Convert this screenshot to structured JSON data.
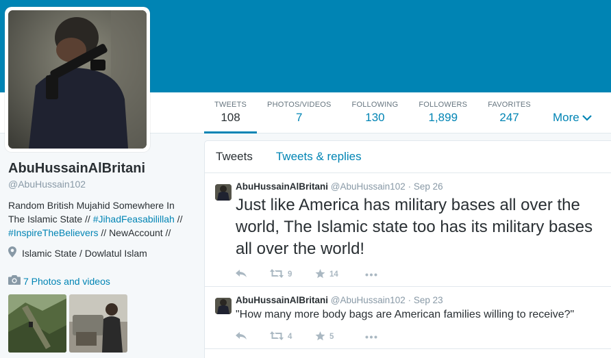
{
  "colors": {
    "brand": "#0084b4",
    "text": "#292f33",
    "muted": "#8899a6"
  },
  "profile": {
    "fullname": "AbuHussainAlBritani",
    "screenname": "@AbuHussain102",
    "bio_line1": "Random British Mujahid Somewhere In The Islamic State // ",
    "bio_tag1": "#JihadFeasabilillah",
    "bio_sep": " // ",
    "bio_tag2": "#InspireTheBelievers",
    "bio_tail": " // NewAccount //",
    "location": "Islamic State / Dowlatul Islam",
    "photos_link": "7 Photos and videos"
  },
  "stats": [
    {
      "label": "TWEETS",
      "value": "108"
    },
    {
      "label": "PHOTOS/VIDEOS",
      "value": "7"
    },
    {
      "label": "FOLLOWING",
      "value": "130"
    },
    {
      "label": "FOLLOWERS",
      "value": "1,899"
    },
    {
      "label": "FAVORITES",
      "value": "247"
    }
  ],
  "more_label": "More",
  "tabs": {
    "tweets": "Tweets",
    "replies": "Tweets & replies"
  },
  "tweets": [
    {
      "name": "AbuHussainAlBritani",
      "handle": "@AbuHussain102",
      "sep": "·",
      "date": "Sep 26",
      "text": "Just like America has military bases all over the world, The Islamic state too has its military bases all over the world!",
      "retweets": "9",
      "favorites": "14"
    },
    {
      "name": "AbuHussainAlBritani",
      "handle": "@AbuHussain102",
      "sep": "·",
      "date": "Sep 23",
      "text": "\"How many more body bags are American families willing to receive?\"",
      "retweets": "4",
      "favorites": "5"
    }
  ],
  "icons": {
    "location": "map-pin-icon",
    "camera": "camera-icon",
    "reply": "reply-icon",
    "retweet": "retweet-icon",
    "favorite": "star-icon",
    "more": "ellipsis-icon",
    "caret": "chevron-down-icon"
  }
}
